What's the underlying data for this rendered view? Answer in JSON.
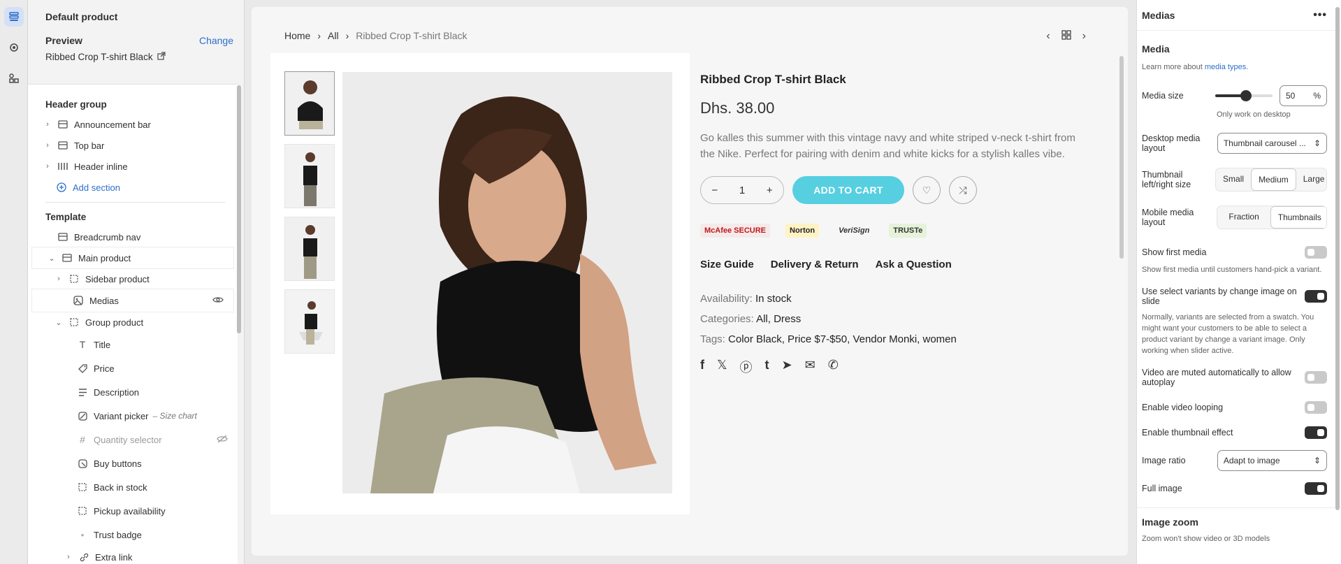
{
  "sidebar": {
    "title": "Default product",
    "preview_label": "Preview",
    "change_link": "Change",
    "preview_value": "Ribbed Crop T-shirt Black",
    "header_group": "Header group",
    "header_items": [
      "Announcement bar",
      "Top bar",
      "Header inline"
    ],
    "add_section": "Add section",
    "template": "Template",
    "breadcrumb": "Breadcrumb nav",
    "main_product": "Main product",
    "sidebar_product": "Sidebar product",
    "medias": "Medias",
    "group_product": "Group product",
    "blocks": [
      "Title",
      "Price",
      "Description",
      "Variant picker",
      "Quantity selector",
      "Buy buttons",
      "Back in stock",
      "Pickup availability",
      "Trust badge"
    ],
    "variant_note": "– Size chart",
    "extra_link": "Extra link"
  },
  "breadcrumb": {
    "home": "Home",
    "all": "All",
    "current": "Ribbed Crop T-shirt Black"
  },
  "product": {
    "title": "Ribbed Crop T-shirt Black",
    "price": "Dhs. 38.00",
    "description": "Go kalles this summer with this vintage navy and white striped v-neck t-shirt from the Nike. Perfect for pairing with denim and white kicks for a stylish kalles vibe.",
    "qty": "1",
    "add_to_cart": "ADD TO CART",
    "badges": [
      "McAfee SECURE",
      "Norton",
      "VeriSign",
      "TRUSTe"
    ],
    "tabs": [
      "Size Guide",
      "Delivery & Return",
      "Ask a Question"
    ],
    "availability_label": "Availability:",
    "availability": "In stock",
    "categories_label": "Categories:",
    "categories": "All, Dress",
    "tags_label": "Tags:",
    "tags": "Color Black, Price $7-$50, Vendor Monki, women"
  },
  "panel": {
    "title": "Medias",
    "section": "Media",
    "help_prefix": "Learn more about ",
    "help_link": "media types.",
    "media_size_label": "Media size",
    "media_size_value": "50",
    "media_size_unit": "%",
    "media_size_fraction": 0.5,
    "media_size_note": "Only work on desktop",
    "desktop_layout_label": "Desktop media layout",
    "desktop_layout_value": "Thumbnail carousel ...",
    "thumb_size_label": "Thumbnail left/right size",
    "thumb_sizes": [
      "Small",
      "Medium",
      "Large"
    ],
    "mobile_layout_label": "Mobile media layout",
    "mobile_layouts": [
      "Fraction",
      "Thumbnails"
    ],
    "show_first_label": "Show first media",
    "show_first_desc": "Show first media until customers hand-pick a variant.",
    "select_variants_label": "Use select variants by change image on slide",
    "select_variants_desc": "Normally, variants are selected from a swatch. You might want your customers to be able to select a product variant by change a variant image. Only working when slider active.",
    "video_muted_label": "Video are muted automatically to allow autoplay",
    "video_loop_label": "Enable video looping",
    "thumb_effect_label": "Enable thumbnail effect",
    "image_ratio_label": "Image ratio",
    "image_ratio_value": "Adapt to image",
    "full_image_label": "Full image",
    "zoom_section": "Image zoom",
    "zoom_desc": "Zoom won't show video or 3D models"
  }
}
